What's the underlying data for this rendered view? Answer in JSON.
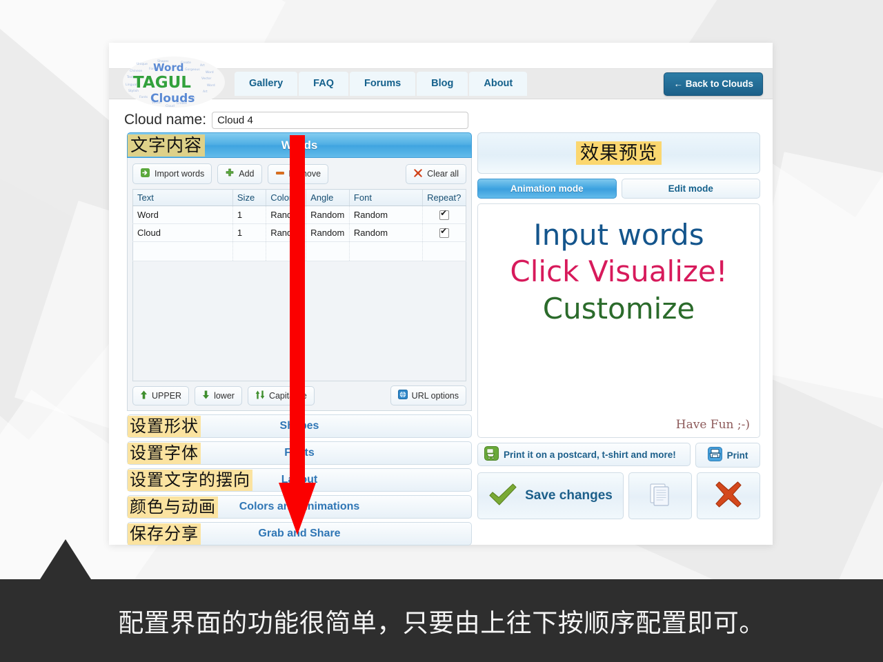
{
  "nav": {
    "items": [
      "Gallery",
      "FAQ",
      "Forums",
      "Blog",
      "About"
    ],
    "back_button": "← Back to Clouds",
    "logo": {
      "word": "Word",
      "tagul": "TAGUL",
      "clouds": "Clouds"
    }
  },
  "cloud_name": {
    "label": "Cloud name:",
    "value": "Cloud 4",
    "placeholder": "Cloud name"
  },
  "words_panel": {
    "header": "Words",
    "header_cn": "文字内容",
    "toolbar": {
      "import": "Import words",
      "add": "Add",
      "remove": "Remove",
      "clear_all": "Clear all"
    },
    "columns": [
      "Text",
      "Size",
      "Color",
      "Angle",
      "Font",
      "Repeat?"
    ],
    "rows": [
      {
        "text": "Word",
        "size": "1",
        "color": "Random",
        "angle": "Random",
        "font": "Random",
        "repeat": true
      },
      {
        "text": "Cloud",
        "size": "1",
        "color": "Random",
        "angle": "Random",
        "font": "Random",
        "repeat": true
      },
      {
        "text": "",
        "size": "",
        "color": "",
        "angle": "",
        "font": "",
        "repeat": false
      }
    ],
    "case_buttons": {
      "upper": "UPPER",
      "lower": "lower",
      "capitalize": "Capitalize",
      "url_options": "URL options"
    }
  },
  "sections": [
    {
      "label": "Shapes",
      "cn": "设置形状"
    },
    {
      "label": "Fonts",
      "cn": "设置字体"
    },
    {
      "label": "Layout",
      "cn": "设置文字的摆向"
    },
    {
      "label": "Colors and Animations",
      "cn": "颜色与动画"
    },
    {
      "label": "Grab and Share",
      "cn": "保存分享"
    }
  ],
  "preview": {
    "title_cn": "效果预览",
    "modes": {
      "animation": "Animation mode",
      "edit": "Edit mode"
    },
    "canvas": {
      "line1": "Input words",
      "line2": "Click Visualize!",
      "line3": "Customize",
      "signature": "Have Fun ;-)"
    },
    "print_postcard": "Print it on a postcard, t-shirt and more!",
    "print": "Print",
    "save_changes": "Save changes"
  },
  "caption": "配置界面的功能很简单，只要由上往下按顺序配置即可。",
  "colors": {
    "accent_blue": "#3fa4e0",
    "nav_blue": "#15618c",
    "arrow_red": "#fb0000",
    "highlight_yellow": "#fbe3a0",
    "highlight_gold": "#fbd770",
    "tag_khaki": "#ded189",
    "footer_dark": "#2e2e2e",
    "canvas_line1": "#14558c",
    "canvas_line2": "#d71a5b",
    "canvas_line3": "#2b6b2b"
  }
}
